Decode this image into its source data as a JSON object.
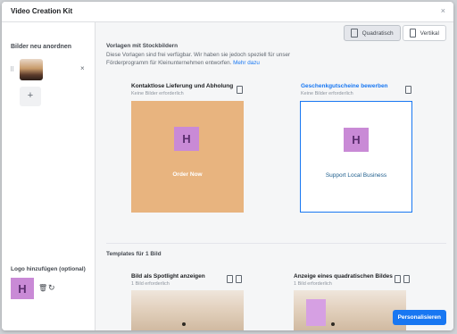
{
  "window": {
    "title": "Video Creation Kit",
    "close_glyph": "×"
  },
  "sidebar": {
    "reorder_title": "Bilder neu anordnen",
    "remove_glyph": "×",
    "add_glyph": "+",
    "logo_title": "Logo hinzufügen (optional)",
    "logo_letter": "H",
    "trash_glyph": "🗑",
    "reload_glyph": "↻"
  },
  "toggles": [
    {
      "label": "Quadratisch",
      "icon": "tablet-icon",
      "active": true
    },
    {
      "label": "Vertikal",
      "icon": "phone-icon",
      "active": false
    }
  ],
  "stock_section": {
    "title": "Vorlagen mit Stockbildern",
    "description": "Diese Vorlagen sind frei verfügbar. Wir haben sie jedoch speziell für unser Förderprogramm für Kleinunternehmen entworfen.",
    "link": "Mehr dazu"
  },
  "templates": [
    {
      "title": "Kontaktlose Lieferung und Abholung",
      "subtitle": "Keine Bilder erforderlich",
      "letter": "H",
      "caption": "Order Now",
      "bg": "#e8b47f",
      "caption_color": "#ffffff"
    },
    {
      "title": "Geschenkgutscheine bewerben",
      "subtitle": "Keine Bilder erforderlich",
      "letter": "H",
      "caption": "Support Local Business",
      "bg": "#ffffff",
      "caption_color": "#1d5d8c",
      "selected": true,
      "title_color": "#1877f2"
    }
  ],
  "one_image_section": {
    "title": "Templates für 1 Bild",
    "items": [
      {
        "title": "Bild als Spotlight anzeigen",
        "subtitle": "1 Bild erforderlich"
      },
      {
        "title": "Anzeige eines quadratischen Bildes",
        "subtitle": "1 Bild erforderlich"
      }
    ]
  },
  "cta": {
    "label": "Personalisieren"
  },
  "colors": {
    "accent": "#1877f2",
    "logo_bg": "#c98ad6",
    "orange": "#e8b47f"
  }
}
